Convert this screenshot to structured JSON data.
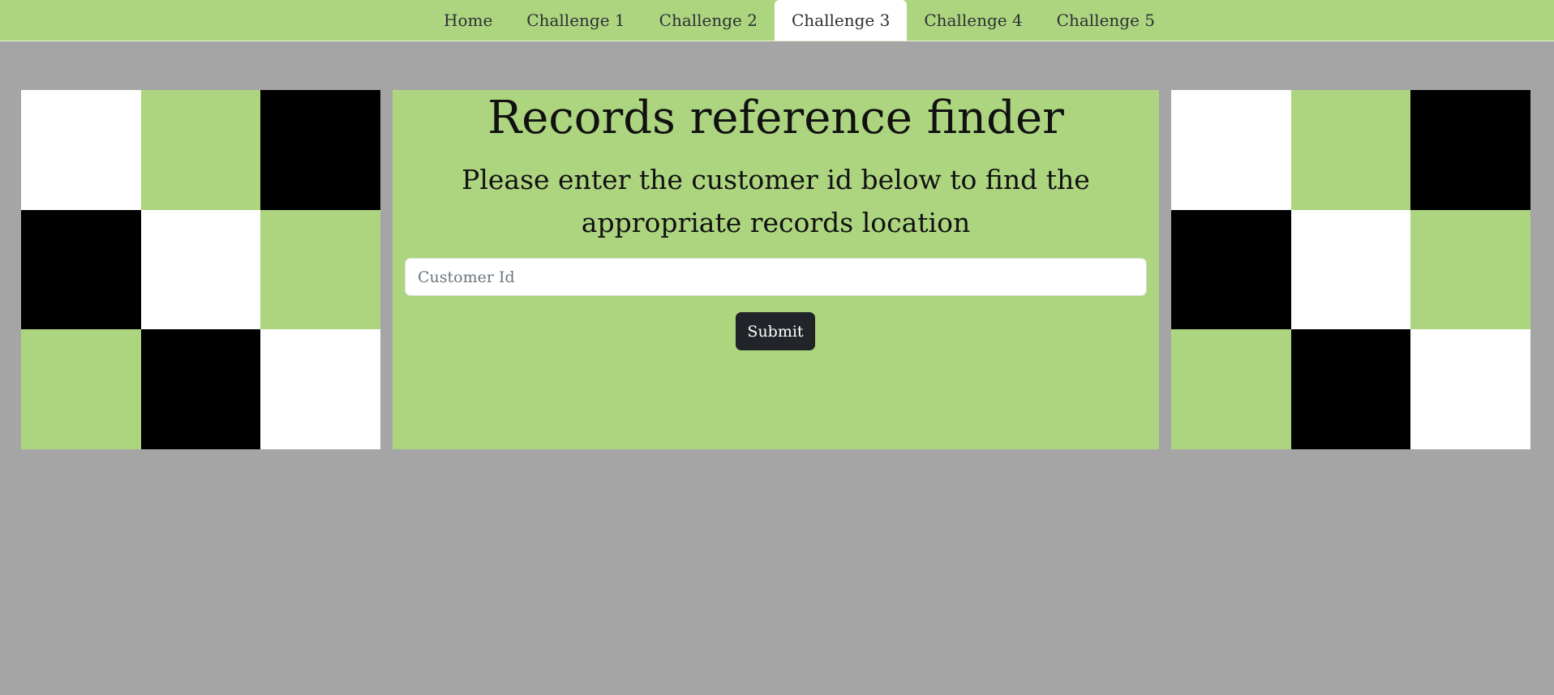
{
  "nav": {
    "items": [
      {
        "label": "Home"
      },
      {
        "label": "Challenge 1"
      },
      {
        "label": "Challenge 2"
      },
      {
        "label": "Challenge 3"
      },
      {
        "label": "Challenge 4"
      },
      {
        "label": "Challenge 5"
      }
    ],
    "active_index": 3
  },
  "main": {
    "title": "Records reference finder",
    "subtitle": "Please enter the customer id below to find the appropriate records location",
    "customer_id": {
      "value": "",
      "placeholder": "Customer Id"
    },
    "submit_label": "Submit"
  },
  "colors": {
    "page_background": "#a5a5a5",
    "brand_green": "#add580",
    "black": "#000000",
    "white": "#ffffff",
    "button_dark": "#212529"
  },
  "decor": {
    "left_pattern": [
      "w",
      "g",
      "b",
      "b",
      "w",
      "g",
      "g",
      "b",
      "w"
    ],
    "right_pattern": [
      "w",
      "g",
      "b",
      "b",
      "w",
      "g",
      "g",
      "b",
      "w"
    ]
  }
}
